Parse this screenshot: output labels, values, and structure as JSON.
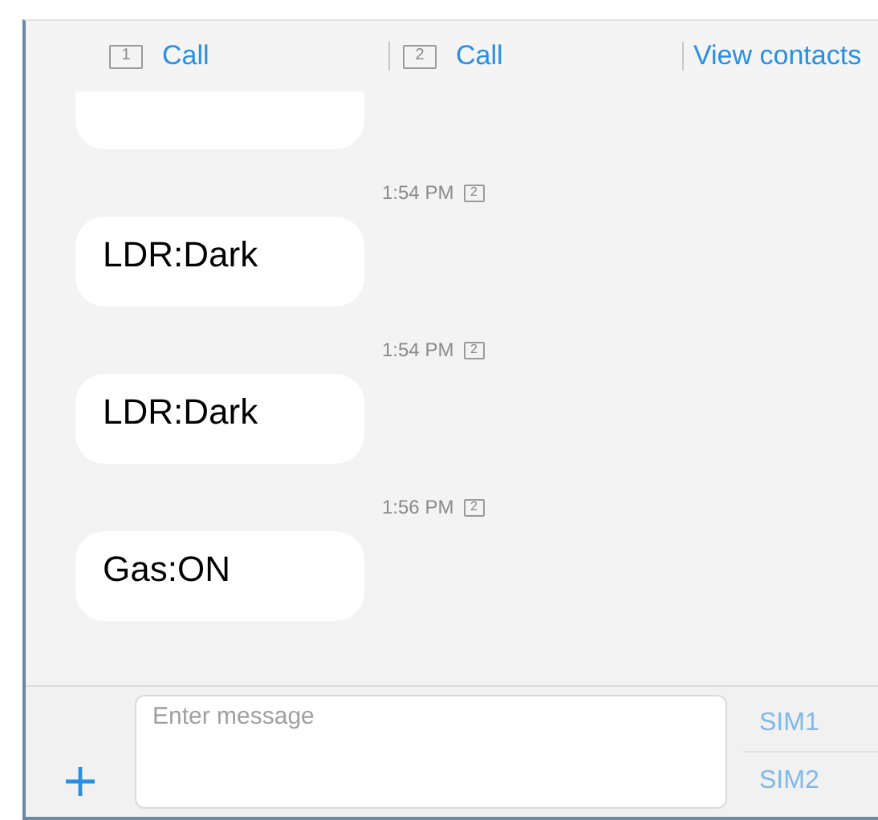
{
  "actions": [
    {
      "sim": "1",
      "label": "Call"
    },
    {
      "sim": "2",
      "label": "Call"
    },
    {
      "label": "View contacts"
    }
  ],
  "messages": [
    {
      "kind": "partial"
    },
    {
      "kind": "message",
      "time": "1:54 PM",
      "sim": "2",
      "text": "LDR:Dark"
    },
    {
      "kind": "message",
      "time": "1:54 PM",
      "sim": "2",
      "text": "LDR:Dark"
    },
    {
      "kind": "message",
      "time": "1:56 PM",
      "sim": "2",
      "text": "Gas:ON"
    }
  ],
  "composer": {
    "placeholder": "Enter message",
    "send_buttons": [
      "SIM1",
      "SIM2"
    ]
  }
}
